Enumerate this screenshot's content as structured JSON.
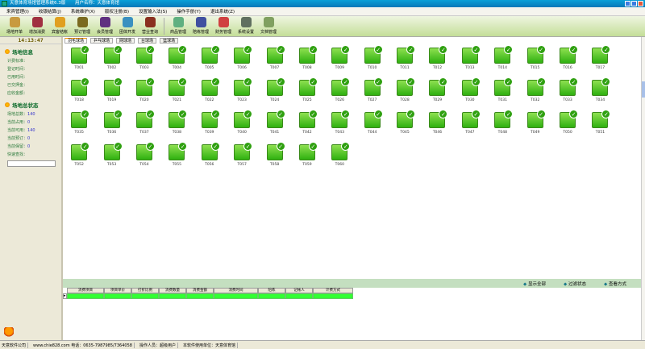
{
  "title": {
    "app": "天意体育场馆管理系统6.3版",
    "user": "用户名称：天意体育馆"
  },
  "menu": [
    "来宾管理(I)",
    "收银结算(J)",
    "系统维护(X)",
    "版权注册(B)",
    "设置输入法(S)",
    "操作手册(Y)",
    "退出系统(Z)"
  ],
  "toolbar": {
    "group1": [
      {
        "label": "场地开单",
        "color": "#c89a40"
      },
      {
        "label": "增加消费",
        "color": "#a03040"
      },
      {
        "label": "宾客结帐",
        "color": "#e0a020"
      },
      {
        "label": "预订管理",
        "color": "#7a6a20"
      },
      {
        "label": "会员管理",
        "color": "#603080"
      },
      {
        "label": "团体开发",
        "color": "#3a90c0"
      },
      {
        "label": "营业查询",
        "color": "#8a3020"
      }
    ],
    "group2": [
      {
        "label": "商品管理",
        "color": "#60b080"
      },
      {
        "label": "陪练管理",
        "color": "#4050a0"
      },
      {
        "label": "财务管理",
        "color": "#d04040"
      },
      {
        "label": "系统设置",
        "color": "#607060"
      },
      {
        "label": "文档管理",
        "color": "#80a060"
      }
    ]
  },
  "clock": "14:13:47",
  "info": {
    "title": "场地信息",
    "rows": [
      "计费标准：",
      "登记时间：",
      "已用时间：",
      "已交押金：",
      "应收金额："
    ]
  },
  "status_panel": {
    "title": "场地总状态",
    "rows": [
      {
        "label": "场地总数：",
        "value": "140"
      },
      {
        "label": "当前占用：",
        "value": "0"
      },
      {
        "label": "当前可用：",
        "value": "140"
      },
      {
        "label": "当前预订：",
        "value": "0"
      },
      {
        "label": "当前保留：",
        "value": "0"
      }
    ],
    "quick_label": "快速查找："
  },
  "tabs": [
    {
      "label": "羽毛球场",
      "active": true
    },
    {
      "label": "乒乓球场"
    },
    {
      "label": "网球场"
    },
    {
      "label": "台球场"
    },
    {
      "label": "篮球场"
    }
  ],
  "court_prefix": "T",
  "court_count": 60,
  "filters": [
    "显示全部",
    "过滤状态",
    "查看方式"
  ],
  "table": {
    "columns": [
      "消费项目",
      "项目单价",
      "打折比例",
      "消费数量",
      "消费金额",
      "消费时间",
      "陪练",
      "记帐人",
      "计费方式"
    ]
  },
  "statusbar": [
    "天意软件公司",
    "www.chie828.com 电话：0635-7987985/7364058",
    "操作人员：超级用户",
    "本软件使用单位：天意体育馆"
  ]
}
